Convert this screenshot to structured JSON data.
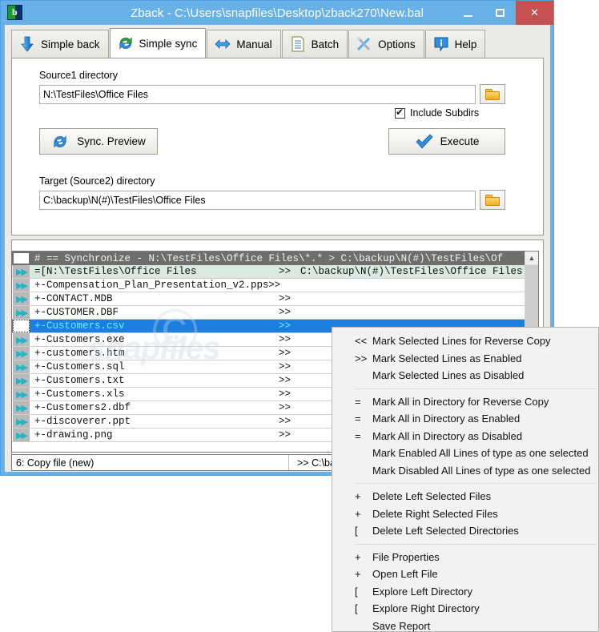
{
  "window": {
    "title": "Zback - C:\\Users\\snapfiles\\Desktop\\zback270\\New.bal",
    "app_icon": "zback-app-icon",
    "minimize_label": "–",
    "maximize_label": "□",
    "close_label": "✕"
  },
  "tabs": [
    {
      "label": "Simple back",
      "icon": "down-arrow-icon",
      "active": false
    },
    {
      "label": "Simple sync",
      "icon": "sync-refresh-icon",
      "active": true
    },
    {
      "label": "Manual",
      "icon": "left-right-arrow-icon",
      "active": false
    },
    {
      "label": "Batch",
      "icon": "document-list-icon",
      "active": false
    },
    {
      "label": "Options",
      "icon": "tools-icon",
      "active": false
    },
    {
      "label": "Help",
      "icon": "info-balloon-icon",
      "active": false
    }
  ],
  "form": {
    "source_label": "Source1 directory",
    "source_value": "N:\\TestFiles\\Office Files",
    "source_browse_icon": "folder-icon",
    "include_subdirs_label": "Include Subdirs",
    "include_subdirs_checked": true,
    "sync_preview_label": "Sync. Preview",
    "sync_preview_icon": "sync-refresh-icon",
    "execute_label": "Execute",
    "execute_icon": "blue-checkmark-icon",
    "target_label": "Target (Source2) directory",
    "target_value": "C:\\backup\\N(#)\\TestFiles\\Office Files",
    "target_browse_icon": "folder-icon"
  },
  "filelist": {
    "header": "# == Synchronize - N:\\TestFiles\\Office Files\\*.* > C:\\backup\\N(#)\\TestFiles\\Of",
    "rows": [
      {
        "name": "=[N:\\TestFiles\\Office Files",
        "mark": ">>",
        "target": "C:\\backup\\N(#)\\TestFiles\\Office Files",
        "kind": "directory",
        "enabled": true,
        "selected": false
      },
      {
        "name": "+-Compensation_Plan_Presentation_v2.pps",
        "mark": ">>",
        "target": "",
        "kind": "file",
        "enabled": true,
        "selected": false
      },
      {
        "name": "+-CONTACT.MDB",
        "mark": ">>",
        "target": "",
        "kind": "file",
        "enabled": true,
        "selected": false
      },
      {
        "name": "+-CUSTOMER.DBF",
        "mark": ">>",
        "target": "",
        "kind": "file",
        "enabled": true,
        "selected": false
      },
      {
        "name": "+-Customers.csv",
        "mark": ">>",
        "target": "",
        "kind": "file",
        "enabled": true,
        "selected": true
      },
      {
        "name": "+-Customers.exe",
        "mark": ">>",
        "target": "",
        "kind": "file",
        "enabled": true,
        "selected": false
      },
      {
        "name": "+-customers.htm",
        "mark": ">>",
        "target": "",
        "kind": "file",
        "enabled": true,
        "selected": false
      },
      {
        "name": "+-Customers.sql",
        "mark": ">>",
        "target": "",
        "kind": "file",
        "enabled": true,
        "selected": false
      },
      {
        "name": "+-Customers.txt",
        "mark": ">>",
        "target": "",
        "kind": "file",
        "enabled": true,
        "selected": false
      },
      {
        "name": "+-Customers.xls",
        "mark": ">>",
        "target": "",
        "kind": "file",
        "enabled": true,
        "selected": false
      },
      {
        "name": "+-Customers2.dbf",
        "mark": ">>",
        "target": "",
        "kind": "file",
        "enabled": true,
        "selected": false
      },
      {
        "name": "+-discoverer.ppt",
        "mark": ">>",
        "target": "",
        "kind": "file",
        "enabled": true,
        "selected": false
      },
      {
        "name": "+-drawing.png",
        "mark": ">>",
        "target": "",
        "kind": "file",
        "enabled": true,
        "selected": false
      }
    ],
    "scroll_up_icon": "chevron-up-icon"
  },
  "statusbar": {
    "left": "6: Copy file (new)",
    "right": ">> C:\\ba"
  },
  "context_menu": {
    "groups": [
      [
        {
          "prefix": "<<",
          "label": "Mark Selected Lines for Reverse Copy"
        },
        {
          "prefix": ">>",
          "label": "Mark Selected Lines as Enabled"
        },
        {
          "prefix": "",
          "label": "Mark Selected Lines as Disabled"
        }
      ],
      [
        {
          "prefix": "=",
          "label": "Mark All in Directory for Reverse Copy"
        },
        {
          "prefix": "=",
          "label": "Mark All in Directory as Enabled"
        },
        {
          "prefix": "=",
          "label": "Mark All in Directory as Disabled"
        },
        {
          "prefix": "",
          "label": "Mark Enabled All Lines of type as one selected"
        },
        {
          "prefix": "",
          "label": "Mark Disabled All Lines of type as one selected"
        }
      ],
      [
        {
          "prefix": "+",
          "label": "Delete Left Selected Files"
        },
        {
          "prefix": "+",
          "label": "Delete Right Selected Files"
        },
        {
          "prefix": "[",
          "label": "Delete Left Selected Directories"
        }
      ],
      [
        {
          "prefix": "+",
          "label": "File Properties"
        },
        {
          "prefix": "+",
          "label": "Open Left File"
        },
        {
          "prefix": "[",
          "label": "Explore Left  Directory"
        },
        {
          "prefix": "[",
          "label": "Explore Right Directory"
        },
        {
          "prefix": "",
          "label": "Save Report"
        }
      ]
    ]
  },
  "watermark": {
    "symbol": "©",
    "text": "snapfiles"
  },
  "colors": {
    "title_bar": "#68b0e8",
    "close_button": "#c75050",
    "selection": "#1a7fe0",
    "directory_row": "#d8e9e0",
    "header_row": "#6e6e6e",
    "enabled_arrow": "#22b5c4"
  }
}
